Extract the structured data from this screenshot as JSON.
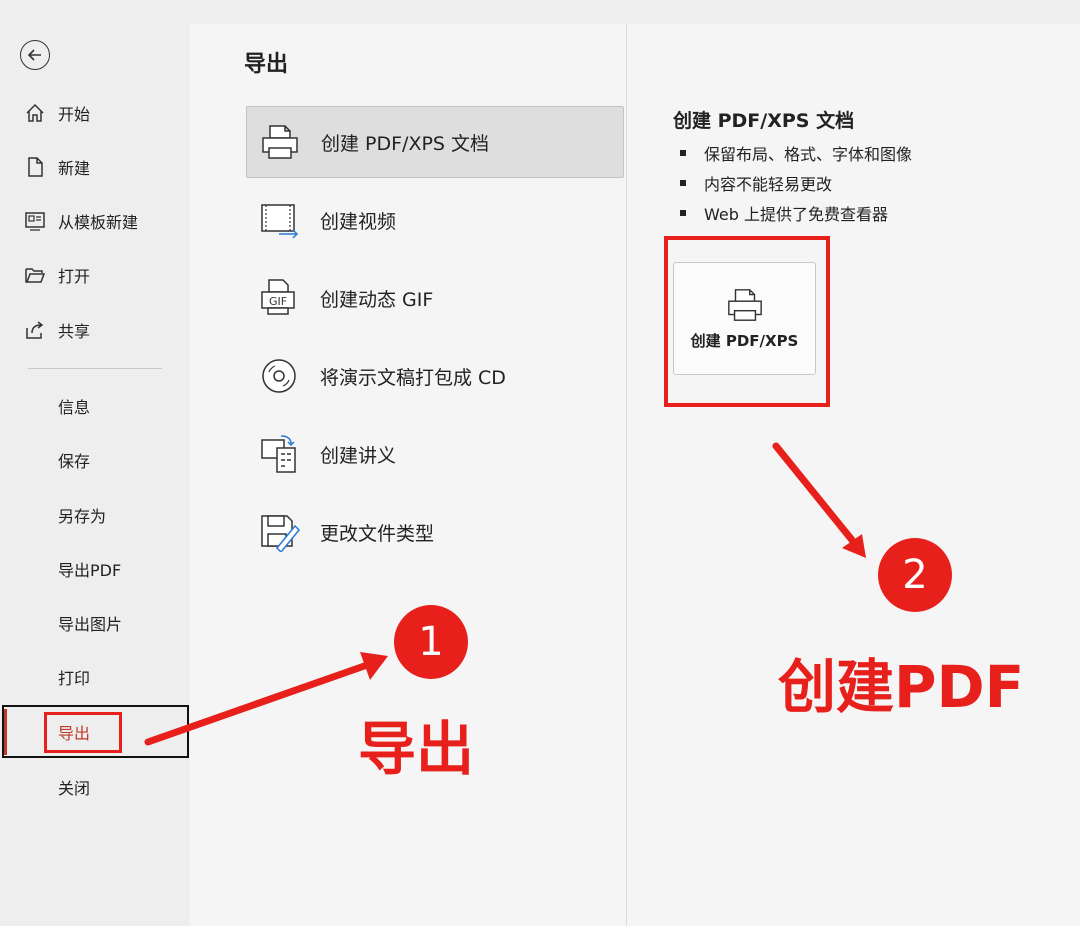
{
  "sidebar": {
    "nav": [
      {
        "label": "开始",
        "icon": "home-icon"
      },
      {
        "label": "新建",
        "icon": "new-file-icon"
      },
      {
        "label": "从模板新建",
        "icon": "template-icon"
      },
      {
        "label": "打开",
        "icon": "folder-open-icon"
      },
      {
        "label": "共享",
        "icon": "share-icon"
      }
    ],
    "sub": [
      {
        "label": "信息"
      },
      {
        "label": "保存"
      },
      {
        "label": "另存为"
      },
      {
        "label": "导出PDF"
      },
      {
        "label": "导出图片"
      },
      {
        "label": "打印"
      },
      {
        "label": "导出",
        "active": true
      },
      {
        "label": "关闭"
      }
    ]
  },
  "main": {
    "title": "导出",
    "options": [
      {
        "label": "创建 PDF/XPS 文档",
        "icon": "printer-icon",
        "selected": true
      },
      {
        "label": "创建视频",
        "icon": "video-icon"
      },
      {
        "label": "创建动态 GIF",
        "icon": "gif-icon"
      },
      {
        "label": "将演示文稿打包成 CD",
        "icon": "cd-icon"
      },
      {
        "label": "创建讲义",
        "icon": "handout-icon"
      },
      {
        "label": "更改文件类型",
        "icon": "change-file-type-icon"
      }
    ]
  },
  "detail": {
    "title": "创建 PDF/XPS 文档",
    "bullets": [
      "保留布局、格式、字体和图像",
      "内容不能轻易更改",
      "Web 上提供了免费查看器"
    ],
    "button_label": "创建 PDF/XPS"
  },
  "annotations": {
    "badge1": "1",
    "badge2": "2",
    "text1": "导出",
    "text2": "创建PDF",
    "accent": "#e8201c"
  }
}
